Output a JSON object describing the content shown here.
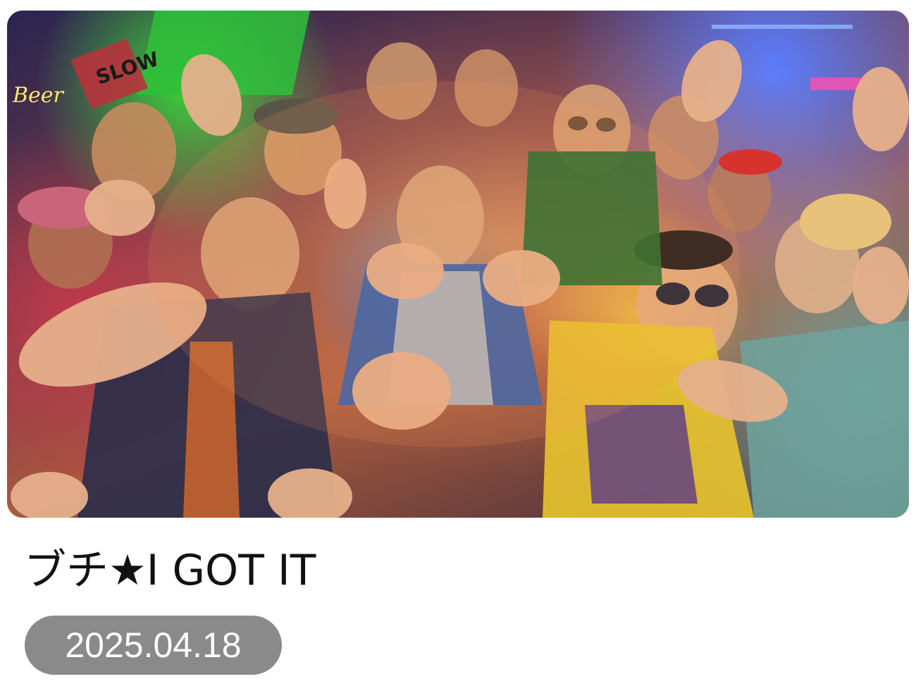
{
  "item": {
    "title": "ブチ★I GOT IT",
    "date": "2025.04.18",
    "thumbnail": {
      "description_icon": "video-thumbnail",
      "sign_text_1": "Beer",
      "sign_text_2": "SLOW"
    }
  },
  "colors": {
    "title": "#111111",
    "badge_bg": "#8a8a8a",
    "badge_text": "#ffffff"
  }
}
